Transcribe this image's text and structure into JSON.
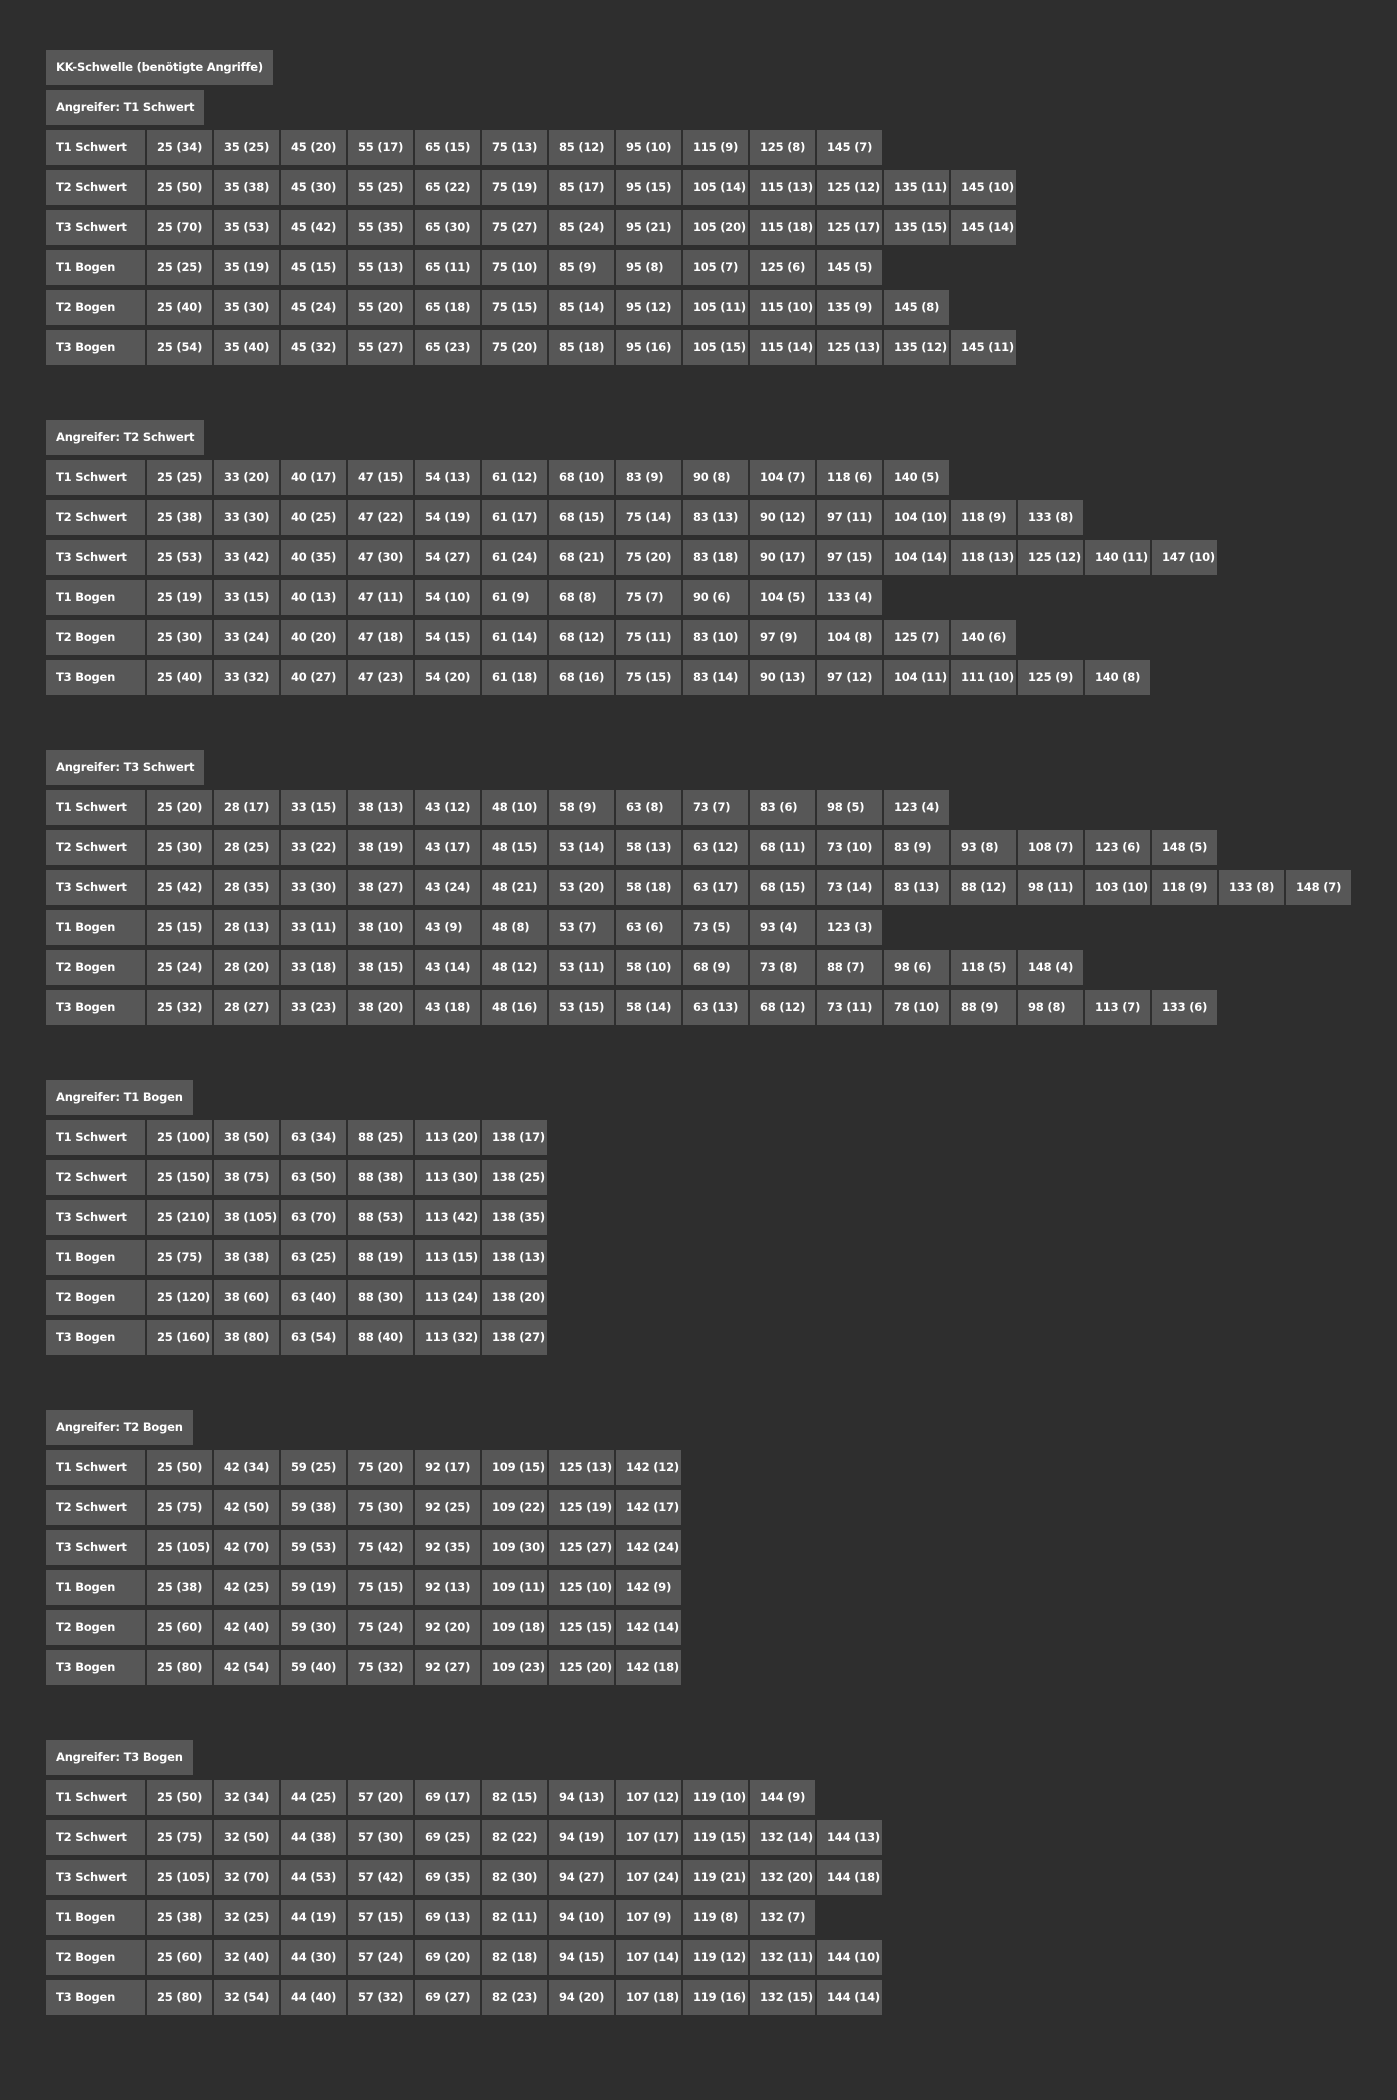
{
  "title": "KK-Schwelle (benötigte Angriffe)",
  "sections": [
    {
      "header": "Angreifer: T1 Schwert",
      "rows": [
        {
          "label": "T1 Schwert",
          "values": [
            "25 (34)",
            "35 (25)",
            "45 (20)",
            "55 (17)",
            "65 (15)",
            "75 (13)",
            "85 (12)",
            "95 (10)",
            "115 (9)",
            "125 (8)",
            "145 (7)"
          ]
        },
        {
          "label": "T2 Schwert",
          "values": [
            "25 (50)",
            "35 (38)",
            "45 (30)",
            "55 (25)",
            "65 (22)",
            "75 (19)",
            "85 (17)",
            "95 (15)",
            "105 (14)",
            "115 (13)",
            "125 (12)",
            "135 (11)",
            "145 (10)"
          ]
        },
        {
          "label": "T3 Schwert",
          "values": [
            "25 (70)",
            "35 (53)",
            "45 (42)",
            "55 (35)",
            "65 (30)",
            "75 (27)",
            "85 (24)",
            "95 (21)",
            "105 (20)",
            "115 (18)",
            "125 (17)",
            "135 (15)",
            "145 (14)"
          ]
        },
        {
          "label": "T1 Bogen",
          "values": [
            "25 (25)",
            "35 (19)",
            "45 (15)",
            "55 (13)",
            "65 (11)",
            "75 (10)",
            "85 (9)",
            "95 (8)",
            "105 (7)",
            "125 (6)",
            "145 (5)"
          ]
        },
        {
          "label": "T2 Bogen",
          "values": [
            "25 (40)",
            "35 (30)",
            "45 (24)",
            "55 (20)",
            "65 (18)",
            "75 (15)",
            "85 (14)",
            "95 (12)",
            "105 (11)",
            "115 (10)",
            "135 (9)",
            "145 (8)"
          ]
        },
        {
          "label": "T3 Bogen",
          "values": [
            "25 (54)",
            "35 (40)",
            "45 (32)",
            "55 (27)",
            "65 (23)",
            "75 (20)",
            "85 (18)",
            "95 (16)",
            "105 (15)",
            "115 (14)",
            "125 (13)",
            "135 (12)",
            "145 (11)"
          ]
        }
      ]
    },
    {
      "header": "Angreifer: T2 Schwert",
      "rows": [
        {
          "label": "T1 Schwert",
          "values": [
            "25 (25)",
            "33 (20)",
            "40 (17)",
            "47 (15)",
            "54 (13)",
            "61 (12)",
            "68 (10)",
            "83 (9)",
            "90 (8)",
            "104 (7)",
            "118 (6)",
            "140 (5)"
          ]
        },
        {
          "label": "T2 Schwert",
          "values": [
            "25 (38)",
            "33 (30)",
            "40 (25)",
            "47 (22)",
            "54 (19)",
            "61 (17)",
            "68 (15)",
            "75 (14)",
            "83 (13)",
            "90 (12)",
            "97 (11)",
            "104 (10)",
            "118 (9)",
            "133 (8)"
          ]
        },
        {
          "label": "T3 Schwert",
          "values": [
            "25 (53)",
            "33 (42)",
            "40 (35)",
            "47 (30)",
            "54 (27)",
            "61 (24)",
            "68 (21)",
            "75 (20)",
            "83 (18)",
            "90 (17)",
            "97 (15)",
            "104 (14)",
            "118 (13)",
            "125 (12)",
            "140 (11)",
            "147 (10)"
          ]
        },
        {
          "label": "T1 Bogen",
          "values": [
            "25 (19)",
            "33 (15)",
            "40 (13)",
            "47 (11)",
            "54 (10)",
            "61 (9)",
            "68 (8)",
            "75 (7)",
            "90 (6)",
            "104 (5)",
            "133 (4)"
          ]
        },
        {
          "label": "T2 Bogen",
          "values": [
            "25 (30)",
            "33 (24)",
            "40 (20)",
            "47 (18)",
            "54 (15)",
            "61 (14)",
            "68 (12)",
            "75 (11)",
            "83 (10)",
            "97 (9)",
            "104 (8)",
            "125 (7)",
            "140 (6)"
          ]
        },
        {
          "label": "T3 Bogen",
          "values": [
            "25 (40)",
            "33 (32)",
            "40 (27)",
            "47 (23)",
            "54 (20)",
            "61 (18)",
            "68 (16)",
            "75 (15)",
            "83 (14)",
            "90 (13)",
            "97 (12)",
            "104 (11)",
            "111 (10)",
            "125 (9)",
            "140 (8)"
          ]
        }
      ]
    },
    {
      "header": "Angreifer: T3 Schwert",
      "rows": [
        {
          "label": "T1 Schwert",
          "values": [
            "25 (20)",
            "28 (17)",
            "33 (15)",
            "38 (13)",
            "43 (12)",
            "48 (10)",
            "58 (9)",
            "63 (8)",
            "73 (7)",
            "83 (6)",
            "98 (5)",
            "123 (4)"
          ]
        },
        {
          "label": "T2 Schwert",
          "values": [
            "25 (30)",
            "28 (25)",
            "33 (22)",
            "38 (19)",
            "43 (17)",
            "48 (15)",
            "53 (14)",
            "58 (13)",
            "63 (12)",
            "68 (11)",
            "73 (10)",
            "83 (9)",
            "93 (8)",
            "108 (7)",
            "123 (6)",
            "148 (5)"
          ]
        },
        {
          "label": "T3 Schwert",
          "values": [
            "25 (42)",
            "28 (35)",
            "33 (30)",
            "38 (27)",
            "43 (24)",
            "48 (21)",
            "53 (20)",
            "58 (18)",
            "63 (17)",
            "68 (15)",
            "73 (14)",
            "83 (13)",
            "88 (12)",
            "98 (11)",
            "103 (10)",
            "118 (9)",
            "133 (8)",
            "148 (7)"
          ]
        },
        {
          "label": "T1 Bogen",
          "values": [
            "25 (15)",
            "28 (13)",
            "33 (11)",
            "38 (10)",
            "43 (9)",
            "48 (8)",
            "53 (7)",
            "63 (6)",
            "73 (5)",
            "93 (4)",
            "123 (3)"
          ]
        },
        {
          "label": "T2 Bogen",
          "values": [
            "25 (24)",
            "28 (20)",
            "33 (18)",
            "38 (15)",
            "43 (14)",
            "48 (12)",
            "53 (11)",
            "58 (10)",
            "68 (9)",
            "73 (8)",
            "88 (7)",
            "98 (6)",
            "118 (5)",
            "148 (4)"
          ]
        },
        {
          "label": "T3 Bogen",
          "values": [
            "25 (32)",
            "28 (27)",
            "33 (23)",
            "38 (20)",
            "43 (18)",
            "48 (16)",
            "53 (15)",
            "58 (14)",
            "63 (13)",
            "68 (12)",
            "73 (11)",
            "78 (10)",
            "88 (9)",
            "98 (8)",
            "113 (7)",
            "133 (6)"
          ]
        }
      ]
    },
    {
      "header": "Angreifer: T1 Bogen",
      "rows": [
        {
          "label": "T1 Schwert",
          "values": [
            "25 (100)",
            "38 (50)",
            "63 (34)",
            "88 (25)",
            "113 (20)",
            "138 (17)"
          ]
        },
        {
          "label": "T2 Schwert",
          "values": [
            "25 (150)",
            "38 (75)",
            "63 (50)",
            "88 (38)",
            "113 (30)",
            "138 (25)"
          ]
        },
        {
          "label": "T3 Schwert",
          "values": [
            "25 (210)",
            "38 (105)",
            "63 (70)",
            "88 (53)",
            "113 (42)",
            "138 (35)"
          ]
        },
        {
          "label": "T1 Bogen",
          "values": [
            "25 (75)",
            "38 (38)",
            "63 (25)",
            "88 (19)",
            "113 (15)",
            "138 (13)"
          ]
        },
        {
          "label": "T2 Bogen",
          "values": [
            "25 (120)",
            "38 (60)",
            "63 (40)",
            "88 (30)",
            "113 (24)",
            "138 (20)"
          ]
        },
        {
          "label": "T3 Bogen",
          "values": [
            "25 (160)",
            "38 (80)",
            "63 (54)",
            "88 (40)",
            "113 (32)",
            "138 (27)"
          ]
        }
      ]
    },
    {
      "header": "Angreifer: T2 Bogen",
      "rows": [
        {
          "label": "T1 Schwert",
          "values": [
            "25 (50)",
            "42 (34)",
            "59 (25)",
            "75 (20)",
            "92 (17)",
            "109 (15)",
            "125 (13)",
            "142 (12)"
          ]
        },
        {
          "label": "T2 Schwert",
          "values": [
            "25 (75)",
            "42 (50)",
            "59 (38)",
            "75 (30)",
            "92 (25)",
            "109 (22)",
            "125 (19)",
            "142 (17)"
          ]
        },
        {
          "label": "T3 Schwert",
          "values": [
            "25 (105)",
            "42 (70)",
            "59 (53)",
            "75 (42)",
            "92 (35)",
            "109 (30)",
            "125 (27)",
            "142 (24)"
          ]
        },
        {
          "label": "T1 Bogen",
          "values": [
            "25 (38)",
            "42 (25)",
            "59 (19)",
            "75 (15)",
            "92 (13)",
            "109 (11)",
            "125 (10)",
            "142 (9)"
          ]
        },
        {
          "label": "T2 Bogen",
          "values": [
            "25 (60)",
            "42 (40)",
            "59 (30)",
            "75 (24)",
            "92 (20)",
            "109 (18)",
            "125 (15)",
            "142 (14)"
          ]
        },
        {
          "label": "T3 Bogen",
          "values": [
            "25 (80)",
            "42 (54)",
            "59 (40)",
            "75 (32)",
            "92 (27)",
            "109 (23)",
            "125 (20)",
            "142 (18)"
          ]
        }
      ]
    },
    {
      "header": "Angreifer: T3 Bogen",
      "rows": [
        {
          "label": "T1 Schwert",
          "values": [
            "25 (50)",
            "32 (34)",
            "44 (25)",
            "57 (20)",
            "69 (17)",
            "82 (15)",
            "94 (13)",
            "107 (12)",
            "119 (10)",
            "144 (9)"
          ]
        },
        {
          "label": "T2 Schwert",
          "values": [
            "25 (75)",
            "32 (50)",
            "44 (38)",
            "57 (30)",
            "69 (25)",
            "82 (22)",
            "94 (19)",
            "107 (17)",
            "119 (15)",
            "132 (14)",
            "144 (13)"
          ]
        },
        {
          "label": "T3 Schwert",
          "values": [
            "25 (105)",
            "32 (70)",
            "44 (53)",
            "57 (42)",
            "69 (35)",
            "82 (30)",
            "94 (27)",
            "107 (24)",
            "119 (21)",
            "132 (20)",
            "144 (18)"
          ]
        },
        {
          "label": "T1 Bogen",
          "values": [
            "25 (38)",
            "32 (25)",
            "44 (19)",
            "57 (15)",
            "69 (13)",
            "82 (11)",
            "94 (10)",
            "107 (9)",
            "119 (8)",
            "132 (7)"
          ]
        },
        {
          "label": "T2 Bogen",
          "values": [
            "25 (60)",
            "32 (40)",
            "44 (30)",
            "57 (24)",
            "69 (20)",
            "82 (18)",
            "94 (15)",
            "107 (14)",
            "119 (12)",
            "132 (11)",
            "144 (10)"
          ]
        },
        {
          "label": "T3 Bogen",
          "values": [
            "25 (80)",
            "32 (54)",
            "44 (40)",
            "57 (32)",
            "69 (27)",
            "82 (23)",
            "94 (20)",
            "107 (18)",
            "119 (16)",
            "132 (15)",
            "144 (14)"
          ]
        }
      ]
    }
  ]
}
